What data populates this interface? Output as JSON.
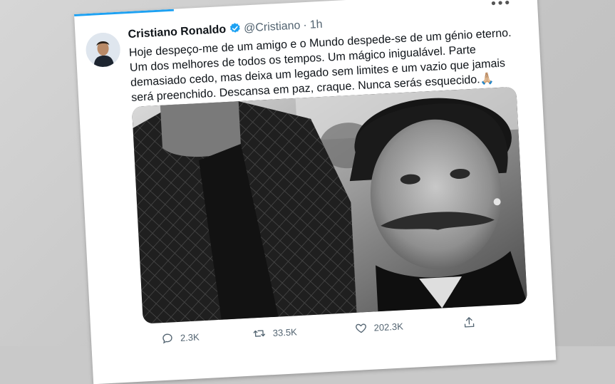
{
  "tweet": {
    "author_name": "Cristiano Ronaldo",
    "handle": "@Cristiano",
    "separator": "·",
    "time": "1h",
    "text_lines": [
      "Hoje despeço-me de um amigo e o Mundo despede-se de um génio eterno.",
      "Um dos melhores de todos os tempos. Um mágico inigualável. Parte",
      "demasiado cedo, mas deixa um legado sem limites e um vazio que jamais",
      "será preenchido. Descansa em paz, craque. Nunca serás esquecido.🙏🏼"
    ]
  },
  "actions": {
    "reply_count": "2.3K",
    "retweet_count": "33.5K",
    "like_count": "202.3K"
  },
  "icons": {
    "more": "more-icon",
    "verified": "verified-badge-icon",
    "reply": "reply-icon",
    "retweet": "retweet-icon",
    "like": "heart-icon",
    "share": "share-icon"
  },
  "colors": {
    "accent": "#1da1f2",
    "muted_text": "#536471",
    "text": "#0f1419"
  }
}
